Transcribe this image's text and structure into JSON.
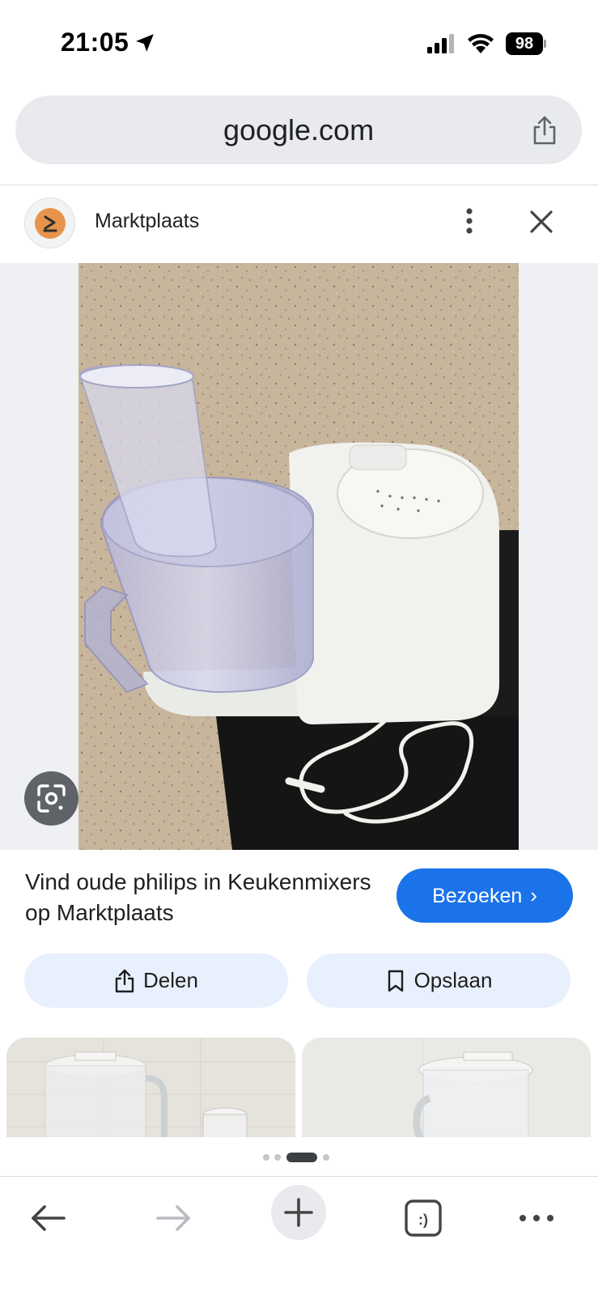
{
  "status_bar": {
    "time": "21:05",
    "battery": "98"
  },
  "address_bar": {
    "url": "google.com"
  },
  "source": {
    "name": "Marktplaats"
  },
  "caption": {
    "title": "Vind oude philips in Keukenmixers op Marktplaats"
  },
  "actions": {
    "visit_label": "Bezoeken",
    "share_label": "Delen",
    "save_label": "Opslaan"
  },
  "pagination": {
    "total_dots": 4,
    "active_index": 2
  },
  "colors": {
    "accent": "#1a73e8",
    "pill_bg": "#e8f0fe",
    "chip_bg": "#e8eaed"
  },
  "icons": [
    "location-arrow-icon",
    "signal-icon",
    "wifi-icon",
    "battery-icon",
    "share-icon",
    "more-vert-icon",
    "close-icon",
    "lens-icon",
    "chevron-right-icon",
    "bookmark-icon",
    "back-icon",
    "forward-icon",
    "plus-icon",
    "tabs-icon",
    "more-horiz-icon"
  ]
}
